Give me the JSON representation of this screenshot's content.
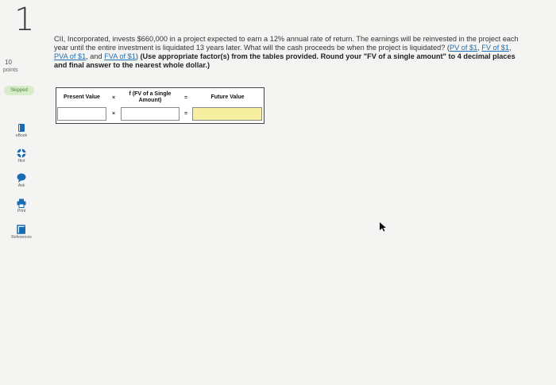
{
  "sidebar": {
    "question_number": "1",
    "points_value": "10",
    "points_label": "points",
    "status_badge": "Skipped",
    "tools": [
      {
        "label": "eBook",
        "icon": "ebook-icon"
      },
      {
        "label": "Hint",
        "icon": "hint-icon"
      },
      {
        "label": "Ask",
        "icon": "ask-icon"
      },
      {
        "label": "Print",
        "icon": "print-icon"
      },
      {
        "label": "References",
        "icon": "references-icon"
      }
    ]
  },
  "question": {
    "text_before": "CII, Incorporated, invests $660,000 in a project expected to earn a 12% annual rate of return. The earnings will be reinvested in the project each year until the entire investment is liquidated 13 years later. What will the cash proceeds be when the project is liquidated? (",
    "links": [
      "PV of $1",
      "FV of $1",
      "PVA of $1",
      "FVA of $1"
    ],
    "sep1": ", ",
    "sep2": ", ",
    "sep3": ", and ",
    "text_after": ")",
    "bold_text": " (Use appropriate factor(s) from the tables provided. Round your \"FV of a single amount\" to 4 decimal places and final answer to the nearest whole dollar.)"
  },
  "calculator": {
    "headers": [
      "Present Value",
      "f (FV of a Single Amount)",
      "Future Value"
    ],
    "operators": [
      "×",
      "=",
      "×",
      "="
    ],
    "inputs": {
      "present_value": "",
      "fv_factor": "",
      "future_value": ""
    }
  },
  "colors": {
    "link": "#1f6fb5",
    "skipped_bg": "#d7ecc9",
    "answer_cell": "#f6ef9f",
    "accent_blue": "#1b6bb3"
  }
}
